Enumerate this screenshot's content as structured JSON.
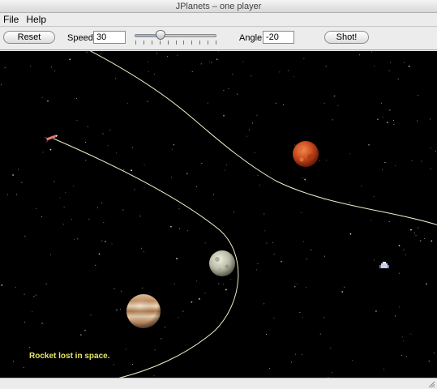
{
  "window": {
    "title": "JPlanets – one player"
  },
  "menu": {
    "items": [
      "File",
      "Help"
    ]
  },
  "toolbar": {
    "reset_label": "Reset",
    "speed_label": "Speed",
    "speed_value": "30",
    "speed_slider_fraction": 0.32,
    "angle_label": "Angle",
    "angle_value": "-20",
    "shot_label": "Shot!"
  },
  "game": {
    "status_message": "Rocket lost in space.",
    "colors": {
      "background": "#000000",
      "trajectory": "#f0edc8",
      "status_text": "#e8e56a"
    },
    "objects": [
      {
        "kind": "planet",
        "name": "red-planet",
        "color": "#c8481c"
      },
      {
        "kind": "planet",
        "name": "grey-moon",
        "color": "#c8c8b4"
      },
      {
        "kind": "planet",
        "name": "gas-giant",
        "color": "#d8a878"
      },
      {
        "kind": "rocket",
        "name": "player-rocket",
        "color": "#e87878"
      },
      {
        "kind": "rocket",
        "name": "target-ship",
        "color": "#a8b8e0"
      }
    ]
  }
}
